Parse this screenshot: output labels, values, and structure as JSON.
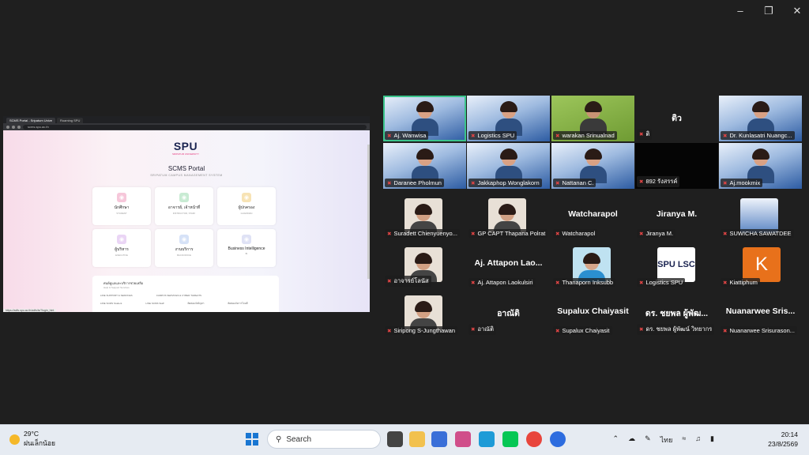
{
  "browser": {
    "tabs": [
      "SCMS Portal - Sripatum Unive",
      "Roaming SPU"
    ],
    "address": "scms.spu.ac.th",
    "status_url": "https://adfs.spu.ac.th/adfs/ls/?login_hint"
  },
  "portal": {
    "logo": "SPU",
    "logo_sub": "SRIPATUM UNIVERSITY",
    "title": "SCMS Portal",
    "subtitle": "SRIPATUM CAMPUS MANAGEMENT SYSTEM",
    "cards": [
      {
        "title": "นักศึกษา",
        "sub": "STUDENT",
        "icon": "graduation-cap-icon",
        "color": "#f6c7da"
      },
      {
        "title": "อาจารย์, เจ้าหน้าที่",
        "sub": "INSTRUCTOR, STAFF",
        "icon": "briefcase-icon",
        "color": "#c8ebd3"
      },
      {
        "title": "ผู้ปกครอง",
        "sub": "GUARDIAN",
        "icon": "shield-icon",
        "color": "#f7e3b5"
      },
      {
        "title": "ผู้บริหาร",
        "sub": "EXECUTIVE",
        "icon": "chart-icon",
        "color": "#ead5f5"
      },
      {
        "title": "งานบริการ",
        "sub": "BACKOFFICE",
        "icon": "layers-icon",
        "color": "#d6e2f7"
      },
      {
        "title": "Business Intelligence",
        "sub": "BI",
        "icon": "bar-chart-icon",
        "color": "#dfe2f5"
      }
    ],
    "panel_title": "ศนย์ดูแลและบริการช่วยเหลือ",
    "panel_sub": "Help & Support Services",
    "panel_cols": [
      "LINE SUPPORT & SERVICES",
      "CAMPUS SERVICES & CYBER THREATS"
    ],
    "panel_items": [
      "LINE SCMS Student",
      "LINE SCMS Staff",
      "ติดต่อแจ้งปัญหา",
      "ติดต่อแจ้งการโจมตี"
    ]
  },
  "participants": [
    {
      "name": "Aj. Wanwisa",
      "type": "video"
    },
    {
      "name": "Logistics SPU",
      "type": "video"
    },
    {
      "name": "warakan Srinualnad",
      "type": "video-green"
    },
    {
      "name": "ติ",
      "big": "ติว",
      "type": "text"
    },
    {
      "name": "Dr. Kunlasatri Nuangc...",
      "type": "video"
    },
    {
      "name": "Daranee Pholmun",
      "type": "video"
    },
    {
      "name": "Jakkaphop Wonglakorn",
      "type": "video"
    },
    {
      "name": "Nattanan C.",
      "type": "video"
    },
    {
      "name": "892 รังสรรค์",
      "type": "black"
    },
    {
      "name": "Aj.mookmix",
      "type": "video"
    },
    {
      "name": "Suradett Chienyuenyo...",
      "type": "avatar"
    },
    {
      "name": "GP CAPT Thapana Polrat",
      "type": "avatar"
    },
    {
      "name": "Watcharapol",
      "big": "Watcharapol",
      "type": "text"
    },
    {
      "name": "Jiranya M.",
      "big": "Jiranya M.",
      "type": "text"
    },
    {
      "name": "SUWICHA SAWATDEE",
      "type": "avatar-slide"
    },
    {
      "name": "อาจารย์โลนัส",
      "type": "avatar"
    },
    {
      "name": "Aj. Attapon Laokulsiri",
      "big": "Aj. Attapon Lao...",
      "type": "text"
    },
    {
      "name": "Thanaporn Inksubb",
      "type": "avatar-blue"
    },
    {
      "name": "Logistics SPU",
      "type": "avatar-spu",
      "logo": "SPU LSC"
    },
    {
      "name": "Kiattiphum",
      "type": "avatar-k",
      "letter": "K"
    },
    {
      "name": "Siripong S-Jungthawan",
      "type": "avatar"
    },
    {
      "name": "อาณัติ",
      "big": "อาณัติ",
      "type": "text"
    },
    {
      "name": "Supalux Chaiyasit",
      "big": "Supalux Chaiyasit",
      "type": "text"
    },
    {
      "name": "ดร. ชยพล ผู้พัฒน์ วิทยากร",
      "big": "ดร. ชยพล ผู้พัฒ...",
      "type": "text"
    },
    {
      "name": "Nuanarwee Srisurason...",
      "big": "Nuanarwee Sris...",
      "type": "text"
    }
  ],
  "taskbar": {
    "temp": "29°C",
    "weather": "ฝนเล็กน้อย",
    "search": "Search",
    "lang": "ไทย",
    "time": "20:14",
    "date": "23/8/2569"
  }
}
